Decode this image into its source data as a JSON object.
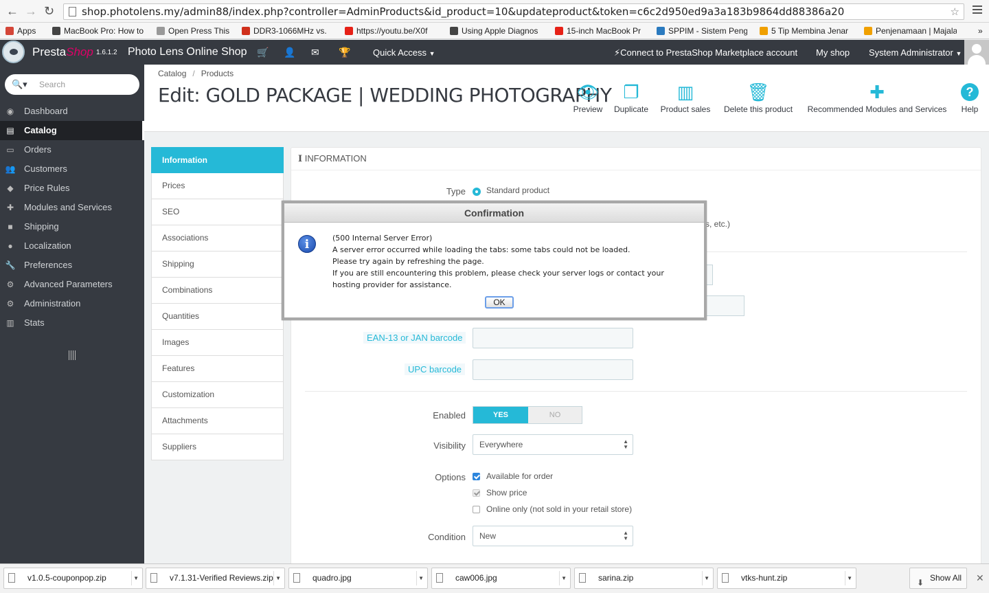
{
  "browser": {
    "url": "shop.photolens.my/admin88/index.php?controller=AdminProducts&id_product=10&updateproduct&token=c6c2d950ed9a3a183b9864dd88386a20",
    "bookmarks": [
      {
        "label": "Apps",
        "color": "#d44638"
      },
      {
        "label": "MacBook Pro: How to",
        "color": "#444444"
      },
      {
        "label": "Open Press This",
        "color": "#999999"
      },
      {
        "label": "DDR3-1066MHz vs.",
        "color": "#d0301c"
      },
      {
        "label": "https://youtu.be/X0f",
        "color": "#e62117"
      },
      {
        "label": "Using Apple Diagnos",
        "color": "#444444"
      },
      {
        "label": "15-inch MacBook Pr",
        "color": "#e62117"
      },
      {
        "label": "SPPIM - Sistem Peng",
        "color": "#2a7abf"
      },
      {
        "label": "5 Tip Membina Jenar",
        "color": "#f0a000"
      },
      {
        "label": "Penjenamaan | Majala",
        "color": "#f0a000"
      }
    ]
  },
  "topbar": {
    "brand_a": "Presta",
    "brand_b": "Shop",
    "version": "1.6.1.2",
    "shop_name": "Photo Lens Online Shop",
    "quick_access": "Quick Access",
    "connect": "Connect to PrestaShop Marketplace account",
    "my_shop": "My shop",
    "user": "System Administrator"
  },
  "sidebar": {
    "search_placeholder": "Search",
    "items": [
      {
        "label": "Dashboard",
        "icon": "dashboard-icon",
        "glyph": "◉"
      },
      {
        "label": "Catalog",
        "icon": "book-icon",
        "glyph": "▤"
      },
      {
        "label": "Orders",
        "icon": "credit-card-icon",
        "glyph": "▭"
      },
      {
        "label": "Customers",
        "icon": "users-icon",
        "glyph": "👥"
      },
      {
        "label": "Price Rules",
        "icon": "tag-icon",
        "glyph": "◆"
      },
      {
        "label": "Modules and Services",
        "icon": "puzzle-icon",
        "glyph": "✚"
      },
      {
        "label": "Shipping",
        "icon": "truck-icon",
        "glyph": "■"
      },
      {
        "label": "Localization",
        "icon": "globe-icon",
        "glyph": "●"
      },
      {
        "label": "Preferences",
        "icon": "wrench-icon",
        "glyph": "🔧"
      },
      {
        "label": "Advanced Parameters",
        "icon": "cogs-icon",
        "glyph": "⚙"
      },
      {
        "label": "Administration",
        "icon": "cog-icon",
        "glyph": "⚙"
      },
      {
        "label": "Stats",
        "icon": "bar-chart-icon",
        "glyph": "▥"
      }
    ]
  },
  "header": {
    "breadcrumb": [
      "Catalog",
      "Products"
    ],
    "title": "Edit: GOLD PACKAGE | WEDDING PHOTOGRAPHY",
    "toolbar": [
      {
        "label": "Preview",
        "icon": "eye-icon",
        "glyph": "👁"
      },
      {
        "label": "Duplicate",
        "icon": "copy-icon",
        "glyph": "❐"
      },
      {
        "label": "Product sales",
        "icon": "bar-chart-icon",
        "glyph": "▥"
      },
      {
        "label": "Delete this product",
        "icon": "trash-icon",
        "glyph": "🗑"
      },
      {
        "label": "Recommended Modules and Services",
        "icon": "puzzle-icon",
        "glyph": "✚"
      },
      {
        "label": "Help",
        "icon": "help-icon",
        "glyph": "?"
      }
    ]
  },
  "tabs": [
    "Information",
    "Prices",
    "SEO",
    "Associations",
    "Shipping",
    "Combinations",
    "Quantities",
    "Images",
    "Features",
    "Customization",
    "Attachments",
    "Suppliers"
  ],
  "form": {
    "panel_title": "INFORMATION",
    "type_label": "Type",
    "type_value": "Standard product",
    "partial_text": "s, etc.)",
    "ean_label": "EAN-13 or JAN barcode",
    "upc_label": "UPC barcode",
    "enabled_label": "Enabled",
    "yes": "YES",
    "no": "NO",
    "visibility_label": "Visibility",
    "visibility_value": "Everywhere",
    "options_label": "Options",
    "opt_available": "Available for order",
    "opt_show_price": "Show price",
    "opt_online_only": "Online only (not sold in your retail store)",
    "condition_label": "Condition",
    "condition_value": "New"
  },
  "dialog": {
    "title": "Confirmation",
    "lines": [
      "(500 Internal Server Error)",
      "A server error occurred while loading the tabs: some tabs could not be loaded.",
      "Please try again by refreshing the page.",
      "If you are still encountering this problem, please check your server logs or contact your hosting provider for assistance."
    ],
    "ok": "OK"
  },
  "downloads": {
    "items": [
      "v1.0.5-couponpop.zip",
      "v7.1.31-Verified Reviews.zip",
      "quadro.jpg",
      "caw006.jpg",
      "sarina.zip",
      "vtks-hunt.zip"
    ],
    "show_all": "Show All"
  }
}
